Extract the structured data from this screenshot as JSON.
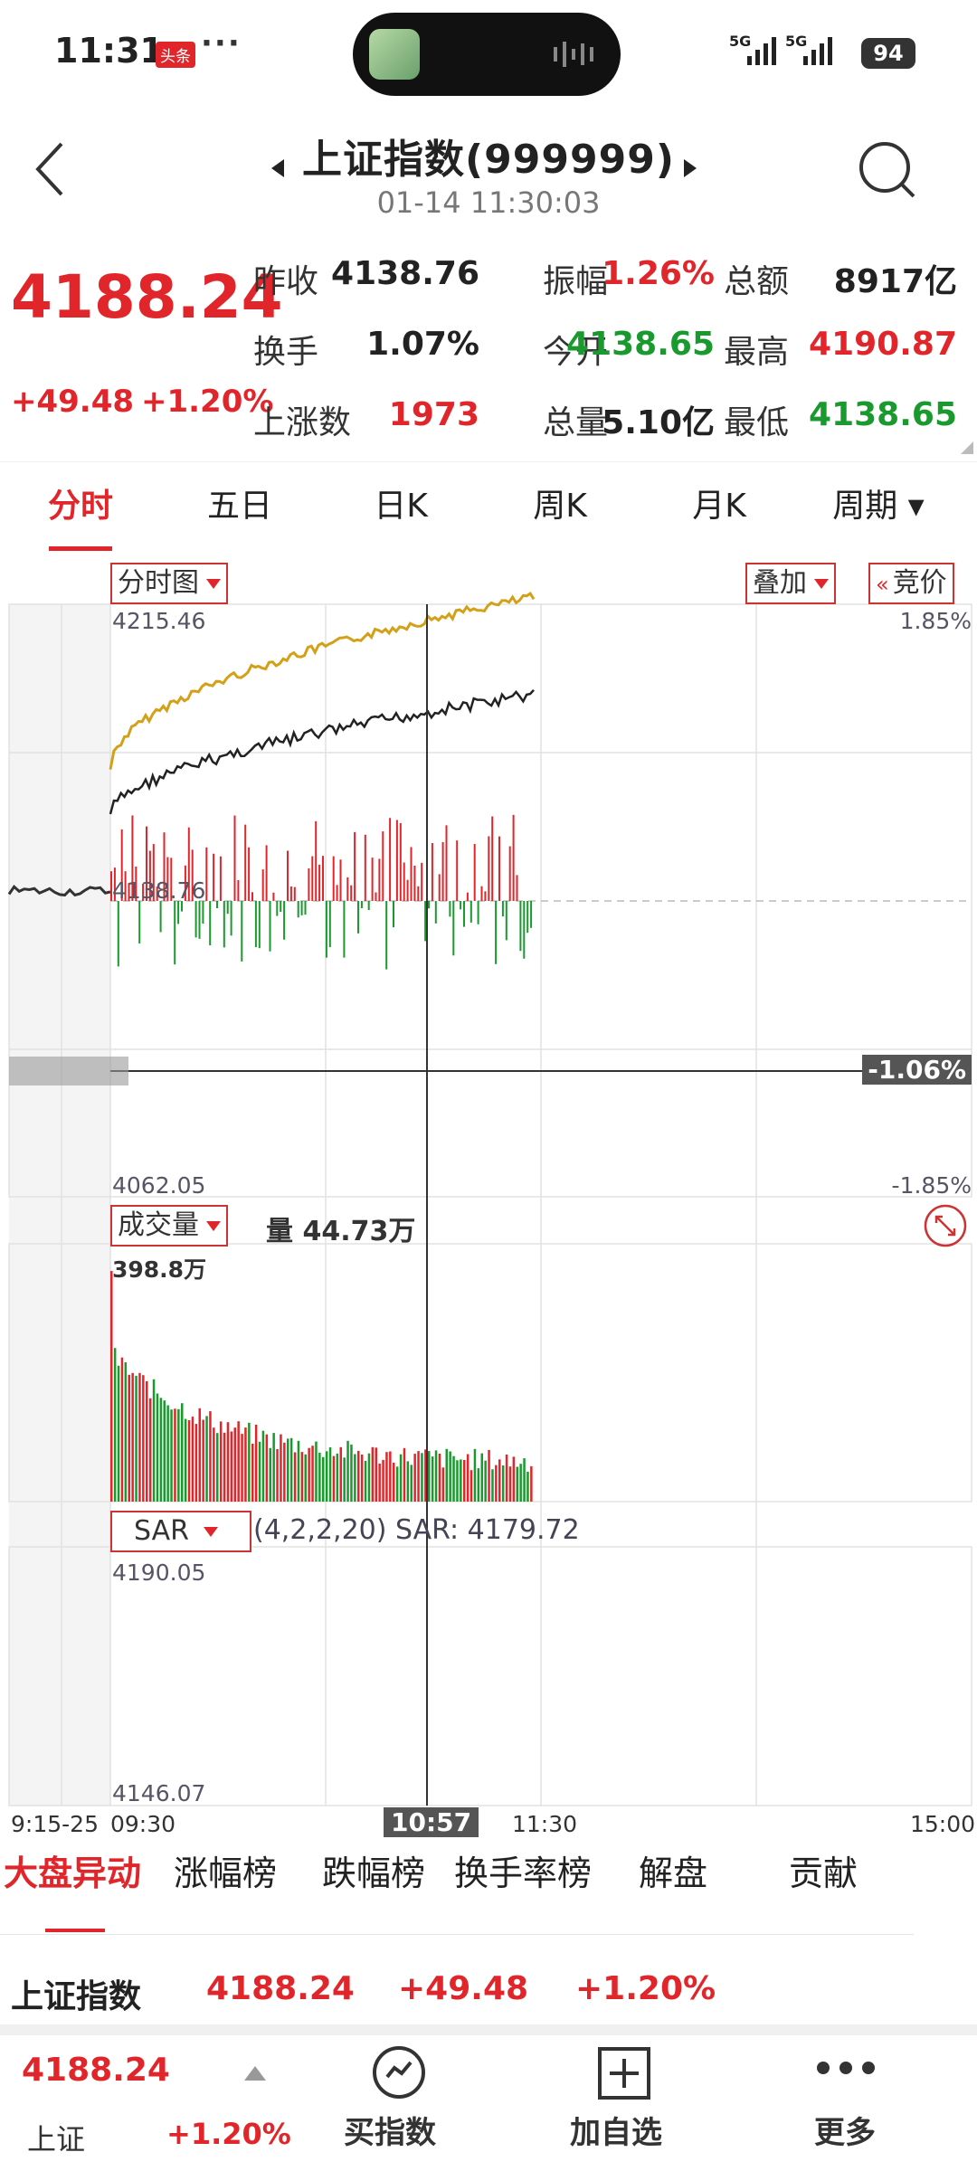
{
  "status_bar": {
    "time": "11:31",
    "badge": "头条",
    "dots": "···",
    "sig1": "5G",
    "sig2": "5G",
    "battery": "94"
  },
  "header": {
    "title": "上证指数(999999)",
    "subtitle": "01-14 11:30:03"
  },
  "quote": {
    "price": "4188.24",
    "change": "+49.48",
    "change_pct": "+1.20%",
    "rows": [
      [
        {
          "label": "昨收",
          "value": "4138.76",
          "color": "#222222"
        },
        {
          "label": "振幅",
          "value": "1.26%",
          "color": "#e0262b"
        },
        {
          "label": "总额",
          "value": "8917亿",
          "color": "#222222"
        }
      ],
      [
        {
          "label": "换手",
          "value": "1.07%",
          "color": "#222222"
        },
        {
          "label": "今开",
          "value": "4138.65",
          "color": "#1a9a2e"
        },
        {
          "label": "最高",
          "value": "4190.87",
          "color": "#e0262b"
        }
      ],
      [
        {
          "label": "上涨数",
          "value": "1973",
          "color": "#e0262b"
        },
        {
          "label": "总量",
          "value": "5.10亿",
          "color": "#222222"
        },
        {
          "label": "最低",
          "value": "4138.65",
          "color": "#1a9a2e"
        }
      ]
    ]
  },
  "period_tabs": [
    "分时",
    "五日",
    "日K",
    "周K",
    "月K",
    "周期"
  ],
  "chart": {
    "type_btn": "分时图",
    "overlay_btn": "叠加",
    "auction_btn": "竞价",
    "y_top": "4215.46",
    "y_mid": "4138.76",
    "y_bot": "4062.05",
    "pct_top": "1.85%",
    "pct_cross": "-1.06%",
    "pct_bot": "-1.85%",
    "vol_btn": "成交量",
    "vol_label": "量 44.73万",
    "vol_max": "398.8万",
    "sar_btn": "SAR",
    "sar_label": "(4,2,2,20) SAR: 4179.72",
    "sar_top": "4190.05",
    "sar_bot": "4146.07",
    "time_labels": [
      "9:15-25",
      "09:30",
      "11:30",
      "15:00"
    ],
    "cursor_time": "10:57"
  },
  "chart_data": {
    "type": "line",
    "title": "",
    "xlabel": "",
    "ylabel": "",
    "ylim": [
      4062.05,
      4215.46
    ],
    "series": []
  },
  "bottom_tabs": [
    "大盘异动",
    "涨幅榜",
    "跌幅榜",
    "换手率榜",
    "解盘",
    "贡献"
  ],
  "list_row": {
    "name": "上证指数",
    "price": "4188.24",
    "change": "+49.48",
    "pct": "+1.20%"
  },
  "footer": {
    "price": "4188.24",
    "name": "上证",
    "pct": "+1.20%",
    "buy": "买指数",
    "add": "加自选",
    "more": "更多"
  },
  "colors": {
    "up": "#e0262b",
    "down": "#1a9a2e",
    "avg": "#d4a017"
  }
}
